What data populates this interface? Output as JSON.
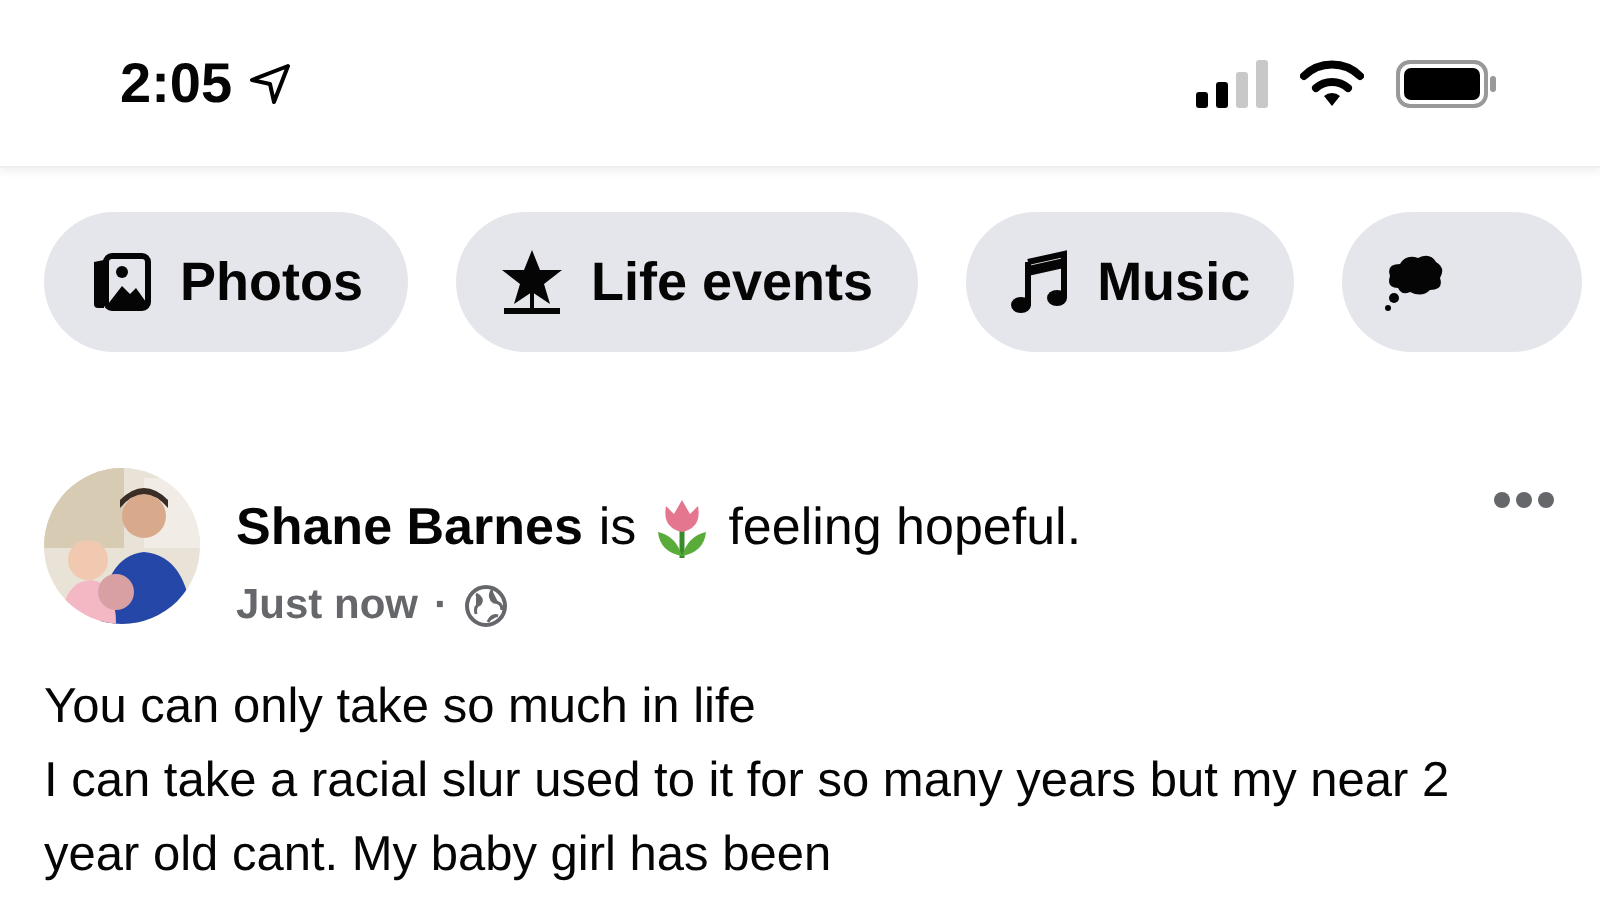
{
  "status_bar": {
    "time": "2:05"
  },
  "chips": [
    {
      "kind": "photos",
      "label": "Photos"
    },
    {
      "kind": "life-event",
      "label": "Life events"
    },
    {
      "kind": "music",
      "label": "Music"
    },
    {
      "kind": "feeling"
    }
  ],
  "post": {
    "author": "Shane Barnes",
    "verb": "is",
    "feeling": "feeling hopeful.",
    "time": "Just now",
    "separator": "·",
    "lines": [
      "You can only take so much in life",
      "I can take a racial slur used to it for so many years but my near 2 year old cant. My baby girl has been"
    ]
  }
}
